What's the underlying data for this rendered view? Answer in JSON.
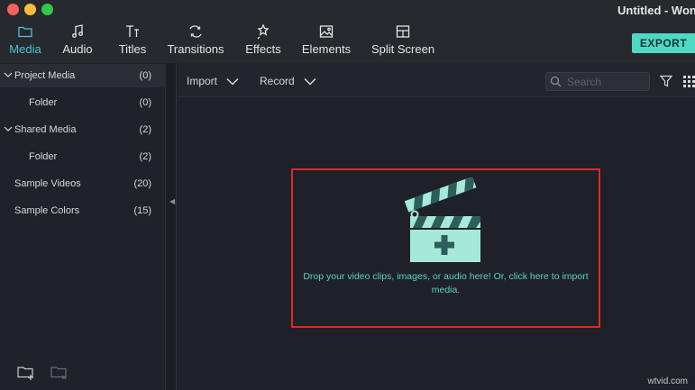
{
  "window": {
    "title": "Untitled - Wondershare Filmora"
  },
  "tabs": [
    {
      "label": "Media",
      "icon": "folder-icon",
      "active": true
    },
    {
      "label": "Audio",
      "icon": "music-note-icon",
      "active": false
    },
    {
      "label": "Titles",
      "icon": "text-icon",
      "active": false
    },
    {
      "label": "Transitions",
      "icon": "transitions-icon",
      "active": false
    },
    {
      "label": "Effects",
      "icon": "effects-icon",
      "active": false
    },
    {
      "label": "Elements",
      "icon": "image-icon",
      "active": false
    },
    {
      "label": "Split Screen",
      "icon": "split-screen-icon",
      "active": false
    }
  ],
  "export_label": "EXPORT",
  "sidebar": {
    "items": [
      {
        "label": "Project Media",
        "count": "(0)",
        "expandable": true
      },
      {
        "label": "Folder",
        "count": "(0)",
        "expandable": false
      },
      {
        "label": "Shared Media",
        "count": "(2)",
        "expandable": true
      },
      {
        "label": "Folder",
        "count": "(2)",
        "expandable": false
      },
      {
        "label": "Sample Videos",
        "count": "(20)",
        "expandable": false
      },
      {
        "label": "Sample Colors",
        "count": "(15)",
        "expandable": false
      }
    ]
  },
  "media_toolbar": {
    "import_label": "Import",
    "record_label": "Record",
    "search_placeholder": "Search"
  },
  "drop_zone": {
    "text": "Drop your video clips, images, or audio here! Or, click here to import media."
  },
  "colors": {
    "accent": "#4fc3d9",
    "export": "#4fd8c2",
    "highlight_border": "#e0262b",
    "clapper": "#a6e9d9"
  },
  "watermark": "wtvid.com"
}
